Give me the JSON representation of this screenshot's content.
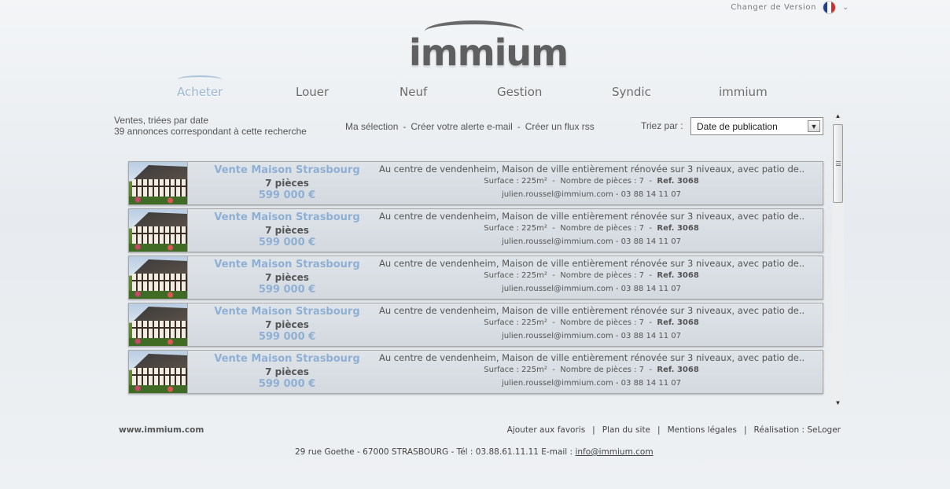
{
  "top": {
    "version_label": "Changer de Version",
    "flag_colors": [
      "#1d3f96",
      "#ffffff",
      "#d12a2a"
    ]
  },
  "logo": {
    "text": "immium"
  },
  "nav": [
    {
      "label": "Acheter",
      "active": true
    },
    {
      "label": "Louer"
    },
    {
      "label": "Neuf"
    },
    {
      "label": "Gestion"
    },
    {
      "label": "Syndic"
    },
    {
      "label": "immium"
    }
  ],
  "results": {
    "line1": "Ventes, triées par date",
    "line2": "39 annonces correspondant à cette recherche"
  },
  "links": {
    "selection": "Ma sélection",
    "alert": "Créer votre alerte e-mail",
    "rss": "Créer un flux rss",
    "separator": "-"
  },
  "sort": {
    "label": "Triez par :",
    "selected": "Date de publication"
  },
  "listings": [
    {
      "title": "Vente Maison Strasbourg",
      "rooms": "7 pièces",
      "price": "599 000 €",
      "description": "Au centre de vendenheim, Maison de ville entièrement rénovée sur 3 niveaux, avec patio de...",
      "surface": "Surface : 225m²",
      "room_count": "Nombre de pièces : 7",
      "ref": "Ref. 3068",
      "contact": "julien.roussel@immium.com - 03 88 14 11 07"
    },
    {
      "title": "Vente Maison Strasbourg",
      "rooms": "7 pièces",
      "price": "599 000 €",
      "description": "Au centre de vendenheim, Maison de ville entièrement rénovée sur 3 niveaux, avec patio de...",
      "surface": "Surface : 225m²",
      "room_count": "Nombre de pièces : 7",
      "ref": "Ref. 3068",
      "contact": "julien.roussel@immium.com - 03 88 14 11 07"
    },
    {
      "title": "Vente Maison Strasbourg",
      "rooms": "7 pièces",
      "price": "599 000 €",
      "description": "Au centre de vendenheim, Maison de ville entièrement rénovée sur 3 niveaux, avec patio de...",
      "surface": "Surface : 225m²",
      "room_count": "Nombre de pièces : 7",
      "ref": "Ref. 3068",
      "contact": "julien.roussel@immium.com - 03 88 14 11 07"
    },
    {
      "title": "Vente Maison Strasbourg",
      "rooms": "7 pièces",
      "price": "599 000 €",
      "description": "Au centre de vendenheim, Maison de ville entièrement rénovée sur 3 niveaux, avec patio de...",
      "surface": "Surface : 225m²",
      "room_count": "Nombre de pièces : 7",
      "ref": "Ref. 3068",
      "contact": "julien.roussel@immium.com - 03 88 14 11 07"
    },
    {
      "title": "Vente Maison Strasbourg",
      "rooms": "7 pièces",
      "price": "599 000 €",
      "description": "Au centre de vendenheim, Maison de ville entièrement rénovée sur 3 niveaux, avec patio de...",
      "surface": "Surface : 225m²",
      "room_count": "Nombre de pièces : 7",
      "ref": "Ref. 3068",
      "contact": "julien.roussel@immium.com - 03 88 14 11 07"
    }
  ],
  "footer": {
    "site": "www.immium.com",
    "favorites": "Ajouter aux favoris",
    "sitemap": "Plan du site",
    "legal": "Mentions légales",
    "credit": "Réalisation : SeLoger",
    "separator": "|",
    "address": "29 rue Goethe - 67000 STRASBOURG  -  Tél : 03.88.61.11.11  E-mail :",
    "email": "info@immium.com"
  },
  "colors": {
    "accent": "#8fb0d4",
    "text": "#555555"
  }
}
